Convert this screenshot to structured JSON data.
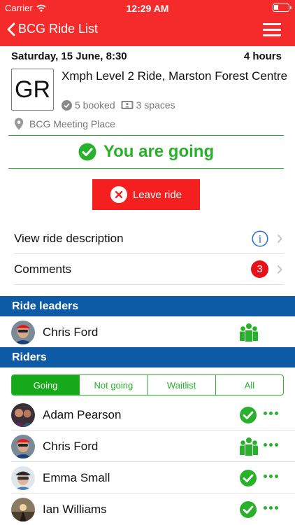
{
  "status_bar": {
    "carrier": "Carrier",
    "time": "12:29 AM"
  },
  "nav": {
    "back_label": "BCG Ride List"
  },
  "ride": {
    "date": "Saturday, 15 June, 8:30",
    "duration": "4 hours",
    "group_code": "GR",
    "title": "Xmph Level 2 Ride, Marston Forest Centre",
    "booked": "5 booked",
    "spaces": "3 spaces",
    "location": "BCG Meeting Place"
  },
  "going_status": "You are going",
  "leave_button": "Leave ride",
  "links": {
    "description": "View ride description",
    "comments": "Comments",
    "comments_count": "3"
  },
  "sections": {
    "leaders": "Ride leaders",
    "riders": "Riders"
  },
  "leaders": [
    {
      "name": "Chris Ford",
      "status_icon": "group-icon"
    }
  ],
  "filter_tabs": [
    "Going",
    "Not going",
    "Waitlist",
    "All"
  ],
  "riders": [
    {
      "name": "Adam Pearson",
      "status_icon": "check-icon"
    },
    {
      "name": "Chris Ford",
      "status_icon": "group-icon"
    },
    {
      "name": "Emma Small",
      "status_icon": "check-icon"
    },
    {
      "name": "Ian Williams",
      "status_icon": "check-icon"
    }
  ],
  "colors": {
    "accent_red": "#f52a2a",
    "green": "#28b12a",
    "section_blue": "#0d5aa7",
    "info_blue": "#1d6fd1"
  }
}
